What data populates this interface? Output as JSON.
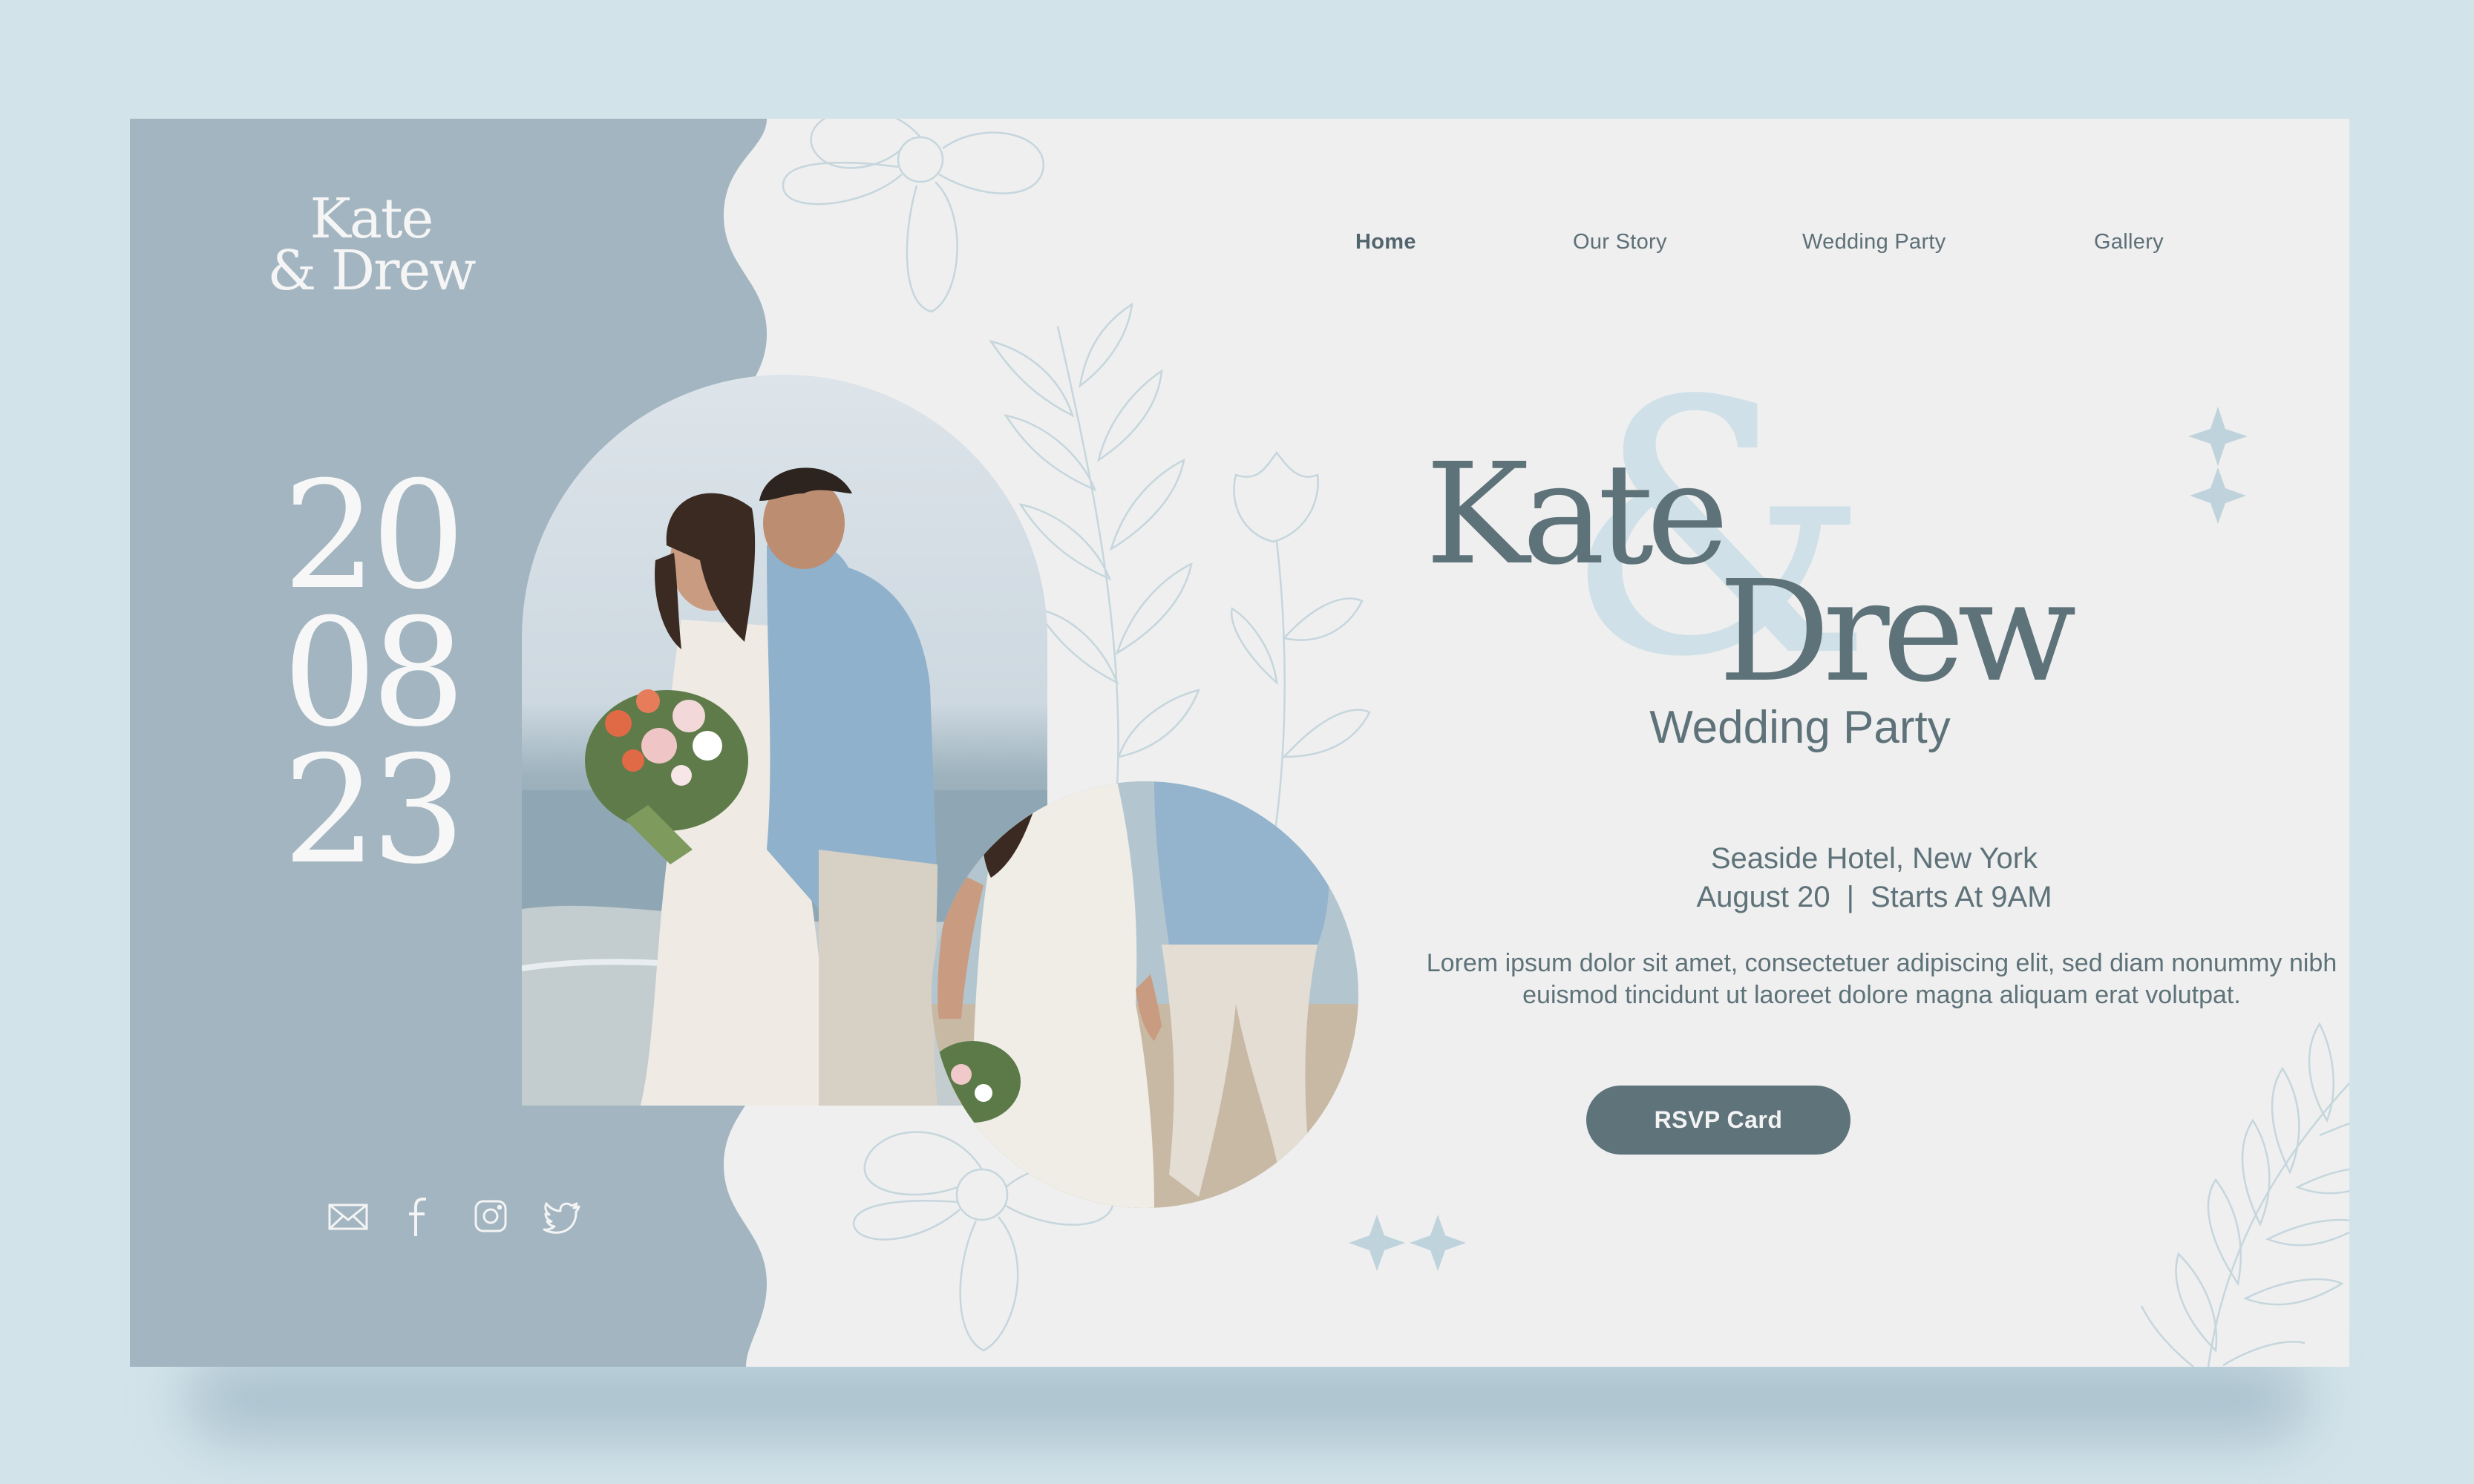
{
  "logo": {
    "line1": "Kate",
    "line2": "& Drew"
  },
  "date": {
    "day": "20",
    "month": "08",
    "year": "23"
  },
  "nav": {
    "items": [
      {
        "label": "Home",
        "active": true
      },
      {
        "label": "Our Story"
      },
      {
        "label": "Wedding Party"
      },
      {
        "label": "Gallery"
      }
    ]
  },
  "hero": {
    "name1": "Kate",
    "amp": "&",
    "name2": "Drew",
    "subtitle": "Wedding Party",
    "venue": "Seaside Hotel, New York",
    "date": "August 20",
    "separator": "|",
    "time": "Starts At 9AM",
    "body": "Lorem ipsum dolor sit amet, consectetuer adipiscing elit, sed diam nonummy nibh euismod tincidunt ut laoreet dolore magna aliquam erat volutpat.",
    "cta": "RSVP Card"
  },
  "social": [
    "mail-icon",
    "facebook-icon",
    "instagram-icon",
    "twitter-icon"
  ],
  "colors": {
    "background": "#d3e3ea",
    "card": "#efefef",
    "sidebar": "#a2b5c0",
    "accent": "#5f737b",
    "ampersand": "#cfe0e8",
    "line_art": "#c5d6dd"
  }
}
